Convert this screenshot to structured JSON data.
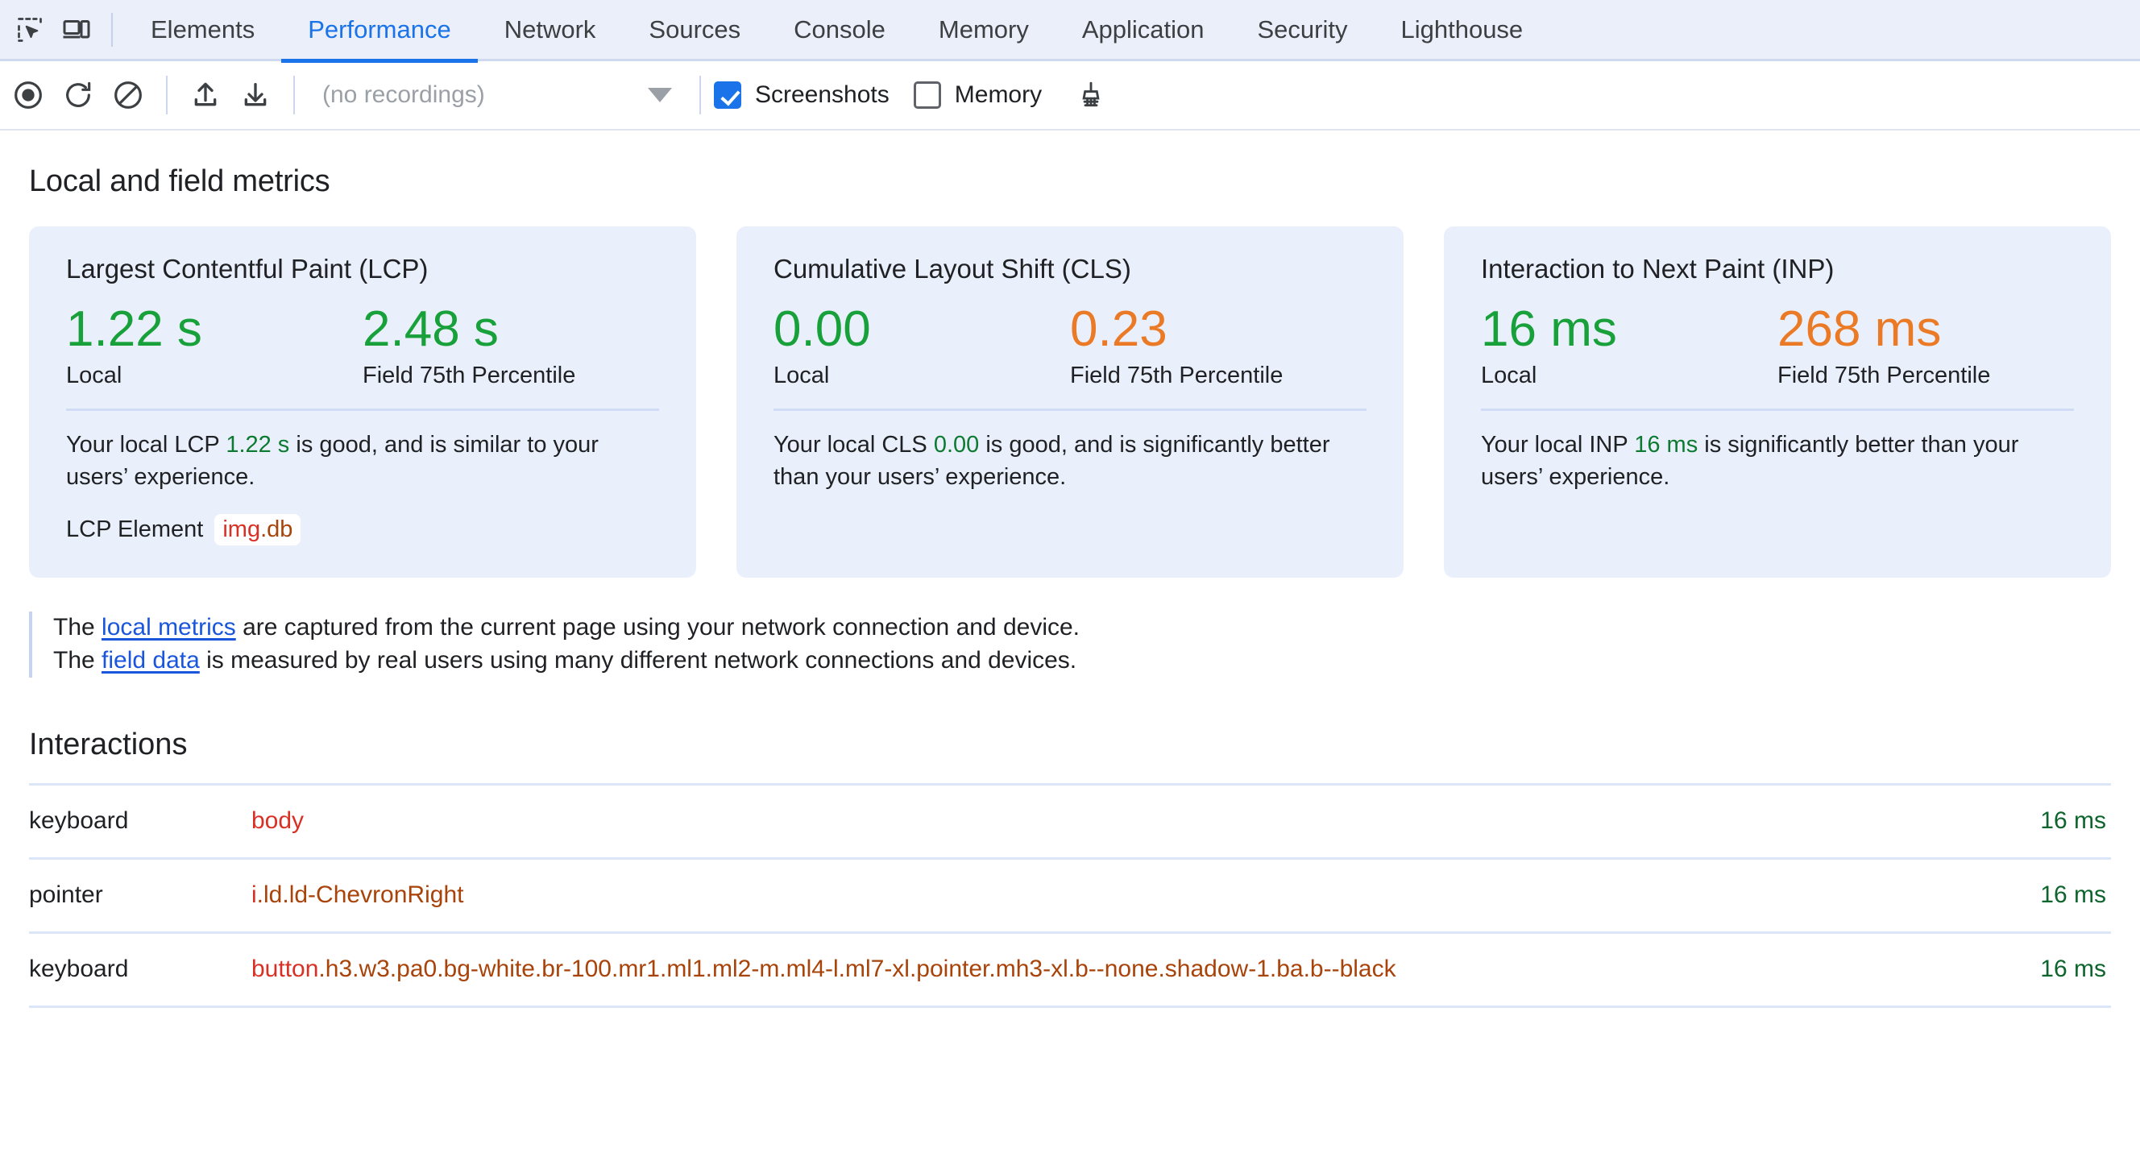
{
  "toolbar_top": {
    "icons": [
      {
        "name": "inspect-element-icon"
      },
      {
        "name": "device-toolbar-icon"
      }
    ],
    "tabs": [
      {
        "label": "Elements",
        "active": false
      },
      {
        "label": "Performance",
        "active": true
      },
      {
        "label": "Network",
        "active": false
      },
      {
        "label": "Sources",
        "active": false
      },
      {
        "label": "Console",
        "active": false
      },
      {
        "label": "Memory",
        "active": false
      },
      {
        "label": "Application",
        "active": false
      },
      {
        "label": "Security",
        "active": false
      },
      {
        "label": "Lighthouse",
        "active": false
      }
    ]
  },
  "toolbar": {
    "record_title": "Record",
    "reload_record_title": "Record and reload",
    "clear_title": "Clear",
    "import_title": "Import profile",
    "export_title": "Save profile",
    "recordings_value": "(no recordings)",
    "screenshots_label": "Screenshots",
    "screenshots_checked": true,
    "memory_label": "Memory",
    "memory_checked": false,
    "collect_garbage_title": "Collect garbage"
  },
  "main": {
    "section_title": "Local and field metrics",
    "cards": [
      {
        "title": "Largest Contentful Paint (LCP)",
        "local_value": "1.22 s",
        "local_label": "Local",
        "local_status": "good",
        "field_value": "2.48 s",
        "field_label": "Field 75th Percentile",
        "field_status": "good",
        "desc_pre": "Your local LCP ",
        "desc_value": "1.22 s",
        "desc_post": " is good, and is similar to your users’ experience.",
        "element_label": "LCP Element",
        "element_tag": "img",
        "element_classes": ".db"
      },
      {
        "title": "Cumulative Layout Shift (CLS)",
        "local_value": "0.00",
        "local_label": "Local",
        "local_status": "good",
        "field_value": "0.23",
        "field_label": "Field 75th Percentile",
        "field_status": "needs",
        "desc_pre": "Your local CLS ",
        "desc_value": "0.00",
        "desc_post": " is good, and is significantly better than your users’ experience."
      },
      {
        "title": "Interaction to Next Paint (INP)",
        "local_value": "16 ms",
        "local_label": "Local",
        "local_status": "good",
        "field_value": "268 ms",
        "field_label": "Field 75th Percentile",
        "field_status": "needs",
        "desc_pre": "Your local INP ",
        "desc_value": "16 ms",
        "desc_post": " is significantly better than your users’ experience."
      }
    ],
    "note": {
      "line1_pre": "The ",
      "line1_link": "local metrics",
      "line1_post": " are captured from the current page using your network connection and device.",
      "line2_pre": "The ",
      "line2_link": "field data",
      "line2_post": " is measured by real users using many different network connections and devices."
    },
    "interactions": {
      "title": "Interactions",
      "rows": [
        {
          "type": "keyboard",
          "tag": "body",
          "classes": "",
          "duration": "16 ms"
        },
        {
          "type": "pointer",
          "tag": "i",
          "classes": ".ld.ld-ChevronRight",
          "duration": "16 ms"
        },
        {
          "type": "keyboard",
          "tag": "button",
          "classes": ".h3.w3.pa0.bg-white.br-100.mr1.ml1.ml2-m.ml4-l.ml7-xl.pointer.mh3-xl.b--none.shadow-1.ba.b--black",
          "duration": "16 ms"
        }
      ]
    }
  },
  "colors": {
    "accent": "#1a73e8",
    "good": "#18a03a",
    "needs_improvement": "#ea7a26",
    "selector_tag": "#d93025",
    "selector_class": "#a8430a",
    "card_bg": "#eaf0fb",
    "duration": "#0d652d"
  }
}
